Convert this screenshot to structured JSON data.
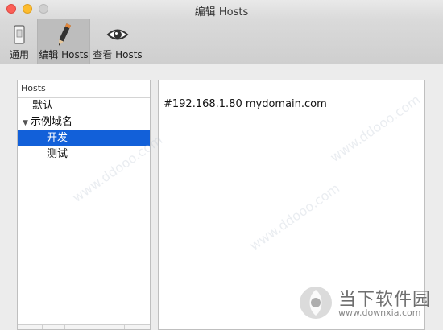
{
  "window": {
    "title": "编辑 Hosts"
  },
  "toolbar": {
    "items": [
      {
        "label": "通用",
        "icon": "general-icon"
      },
      {
        "label": "编辑 Hosts",
        "icon": "pencil-icon",
        "selected": true
      },
      {
        "label": "查看 Hosts",
        "icon": "eye-icon"
      }
    ]
  },
  "sidebar": {
    "header": "Hosts",
    "items": [
      {
        "label": "默认",
        "level": 1
      },
      {
        "label": "示例域名",
        "level": 1,
        "expanded": true
      },
      {
        "label": "开发",
        "level": 2,
        "selected": true
      },
      {
        "label": "测试",
        "level": 2
      }
    ]
  },
  "editor": {
    "content": "#192.168.1.80 mydomain.com"
  },
  "watermark": {
    "brand": "当下软件园",
    "url": "www.downxia.com",
    "tile_text": "www.ddooo.com"
  },
  "colors": {
    "selection": "#1260d9",
    "close": "#fc5f57",
    "minimize": "#fdbc2e"
  }
}
